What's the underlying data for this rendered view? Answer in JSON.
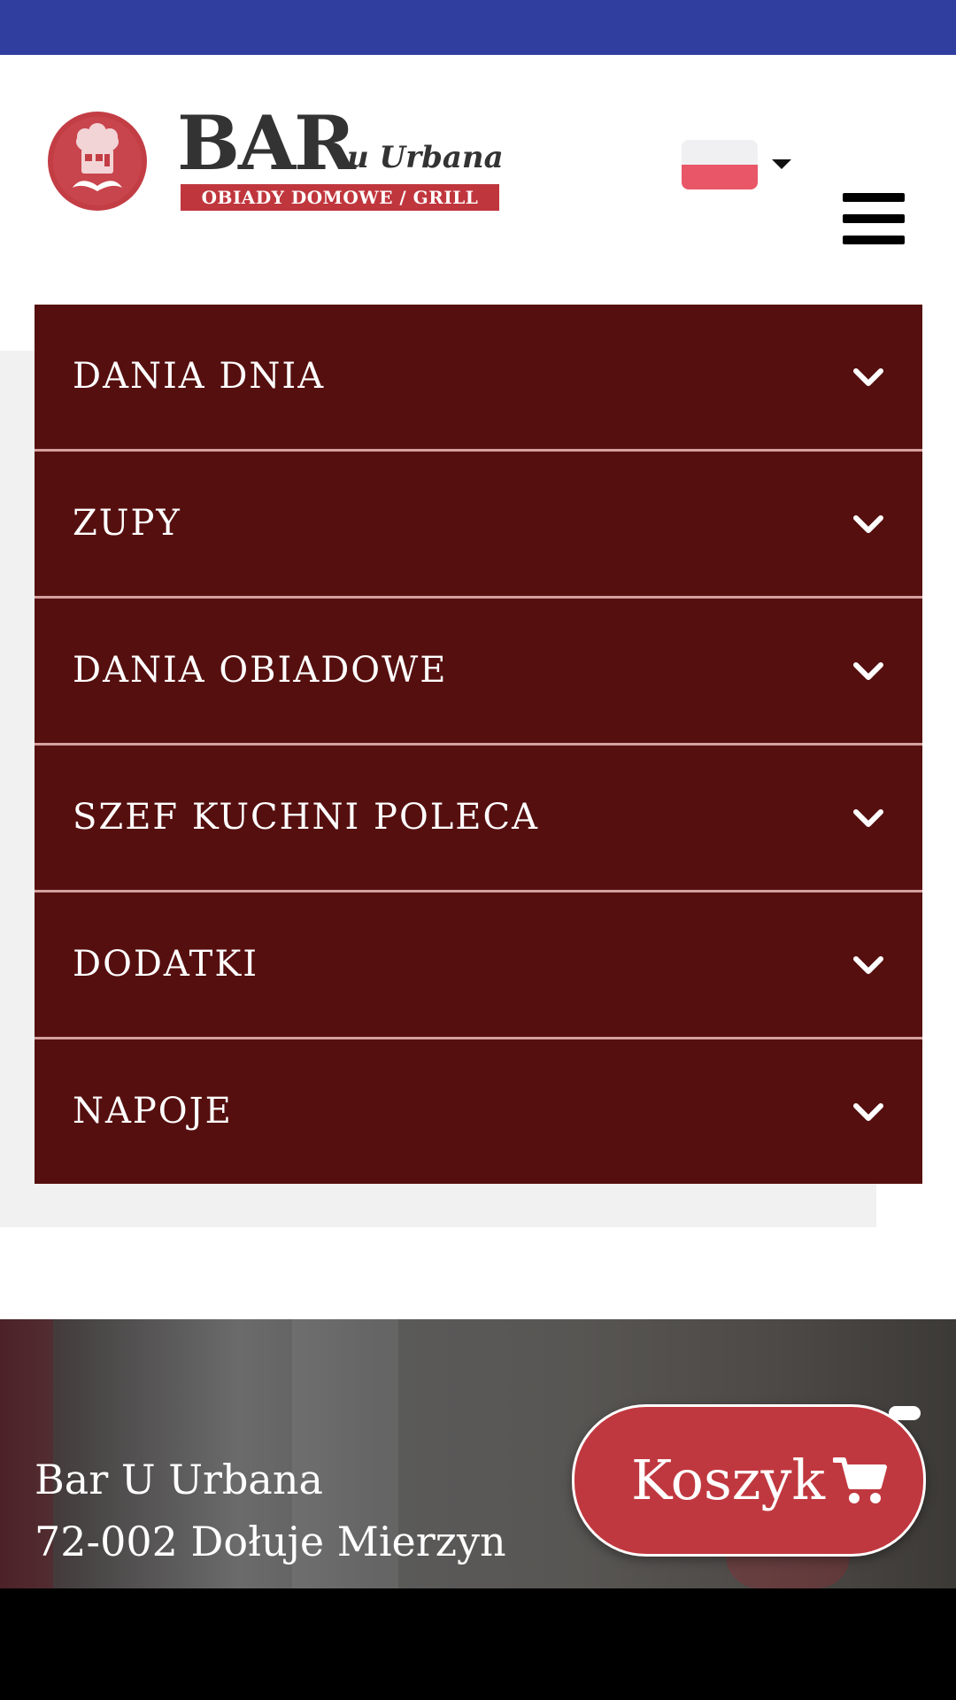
{
  "colors": {
    "top_bar": "#303f9f",
    "menu_background": "#560f0f",
    "menu_divider": "#d4a0a0",
    "brand_red": "#c0383f",
    "flag_white": "#f0f0f3",
    "flag_red": "#e85668"
  },
  "header": {
    "logo": {
      "bar": "BAR",
      "u_urbana": "u Urbana",
      "tagline": "OBIADY DOMOWE / GRILL"
    },
    "language": {
      "icon": "poland-flag-icon",
      "dropdown_icon": "caret-down-icon"
    },
    "menu_toggle_icon": "hamburger-menu-icon"
  },
  "menu": {
    "items": [
      {
        "label": "DANIA DNIA",
        "icon": "chevron-down-icon"
      },
      {
        "label": "ZUPY",
        "icon": "chevron-down-icon"
      },
      {
        "label": "DANIA OBIADOWE",
        "icon": "chevron-down-icon"
      },
      {
        "label": "SZEF KUCHNI POLECA",
        "icon": "chevron-down-icon"
      },
      {
        "label": "DODATKI",
        "icon": "chevron-down-icon"
      },
      {
        "label": "NAPOJE",
        "icon": "chevron-down-icon"
      }
    ]
  },
  "footer": {
    "name": "Bar U Urbana",
    "address": "72-002 Dołuje Mierzyn"
  },
  "cart": {
    "label": "Koszyk",
    "icon": "shopping-cart-icon"
  }
}
